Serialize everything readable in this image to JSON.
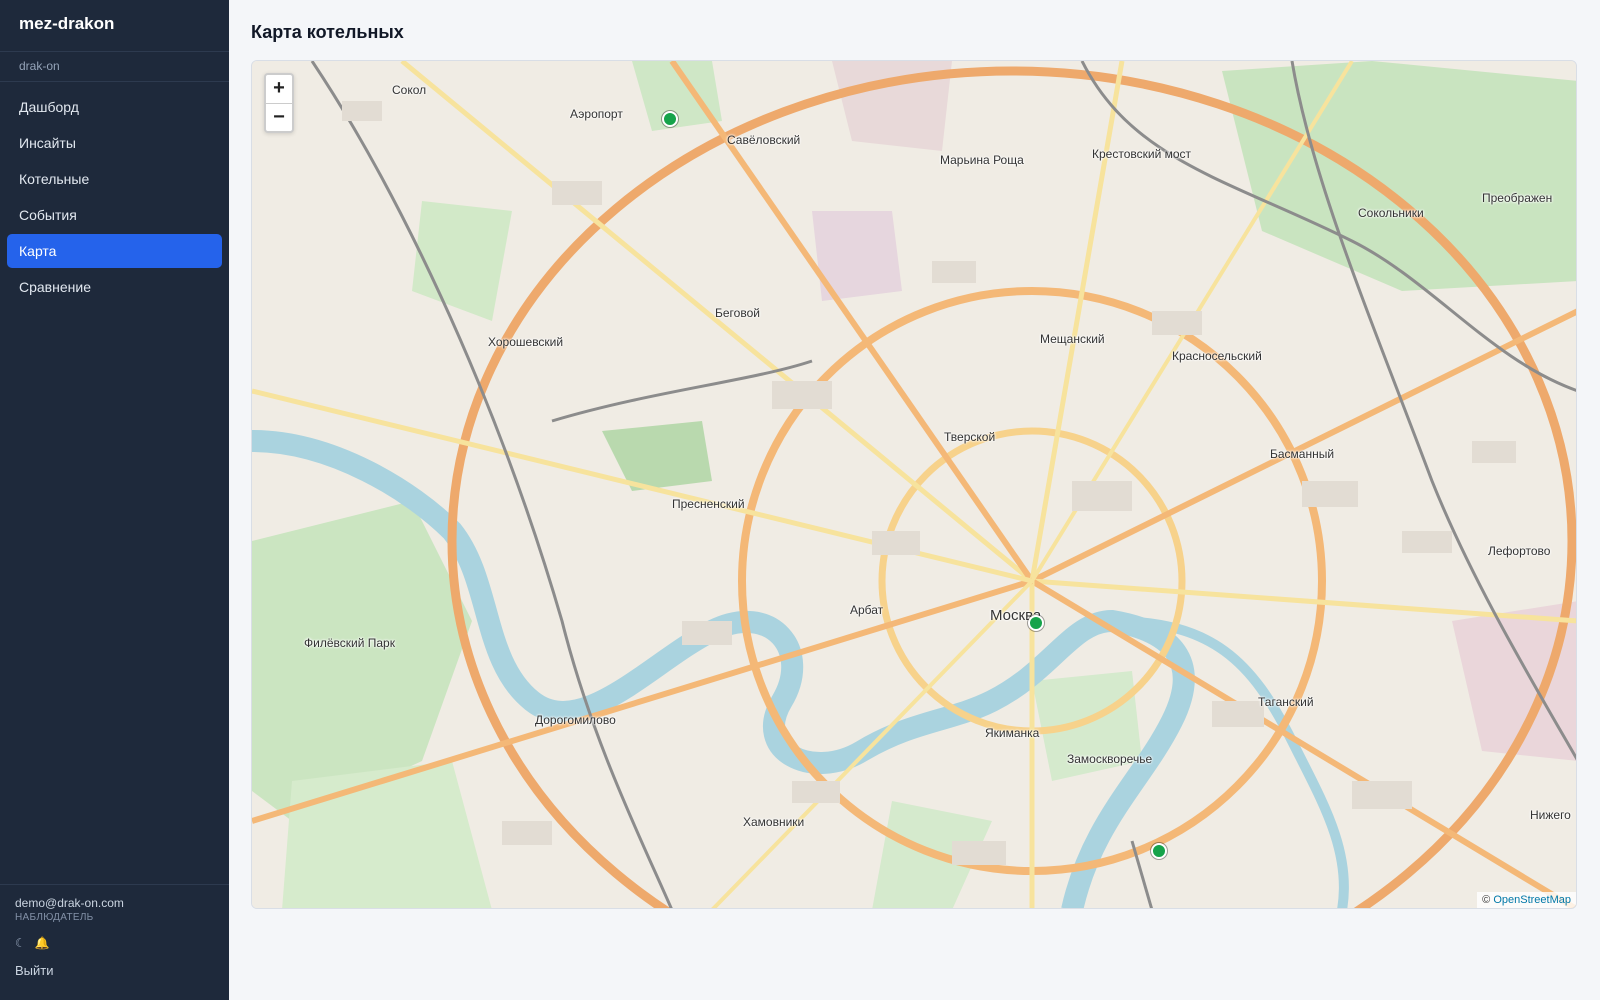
{
  "app": {
    "name": "mez-drakon",
    "org": "drak-on"
  },
  "nav": {
    "items": [
      {
        "label": "Дашборд"
      },
      {
        "label": "Инсайты"
      },
      {
        "label": "Котельные"
      },
      {
        "label": "События"
      },
      {
        "label": "Карта",
        "active": true
      },
      {
        "label": "Сравнение"
      }
    ]
  },
  "user": {
    "email": "demo@drak-on.com",
    "role": "НАБЛЮДАТЕЛЬ"
  },
  "footer": {
    "theme_icon": "☾",
    "notify_icon": "🔔",
    "logout_label": "Выйти"
  },
  "page": {
    "title": "Карта котельных"
  },
  "map": {
    "zoom_in": "+",
    "zoom_out": "−",
    "attribution_prefix": "©",
    "attribution_link": "OpenStreetMap",
    "labels": [
      "Сокол",
      "Аэропорт",
      "Савёловский",
      "Марьина Роща",
      "Крестовский мост",
      "Сокольники",
      "Преображен",
      "Беговой",
      "Хорошевский",
      "Мещанский",
      "Красносельский",
      "Тверской",
      "Басманный",
      "Пресненский",
      "Лефортово",
      "Арбат",
      "Москва",
      "Филёвский Парк",
      "Дорогомилово",
      "Якиманка",
      "Замоскворечье",
      "Таганский",
      "Хамовники",
      "Нижего"
    ],
    "marker_color": "#16a34a"
  }
}
